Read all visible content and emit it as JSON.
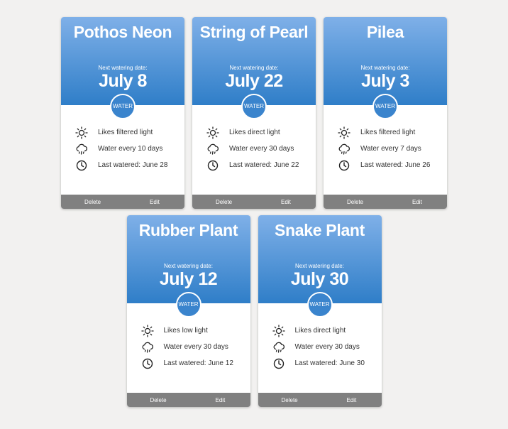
{
  "plants": [
    {
      "name": "Pothos Neon",
      "next_label": "Next watering date:",
      "next_date": "July 8",
      "water_label": "WATER",
      "light": "Likes filtered light",
      "water_freq": "Water every 10 days",
      "last_watered": "Last watered: June 28",
      "delete_label": "Delete",
      "edit_label": "Edit"
    },
    {
      "name": "String of Pearl",
      "next_label": "Next watering date:",
      "next_date": "July 22",
      "water_label": "WATER",
      "light": "Likes direct light",
      "water_freq": "Water every 30 days",
      "last_watered": "Last watered: June 22",
      "delete_label": "Delete",
      "edit_label": "Edit"
    },
    {
      "name": "Pilea",
      "next_label": "Next watering date:",
      "next_date": "July 3",
      "water_label": "WATER",
      "light": "Likes filtered light",
      "water_freq": "Water every 7 days",
      "last_watered": "Last watered: June 26",
      "delete_label": "Delete",
      "edit_label": "Edit"
    },
    {
      "name": "Rubber Plant",
      "next_label": "Next watering date:",
      "next_date": "July 12",
      "water_label": "WATER",
      "light": "Likes low light",
      "water_freq": "Water every 30 days",
      "last_watered": "Last watered: June 12",
      "delete_label": "Delete",
      "edit_label": "Edit"
    },
    {
      "name": "Snake Plant",
      "next_label": "Next watering date:",
      "next_date": "July 30",
      "water_label": "WATER",
      "light": "Likes direct light",
      "water_freq": "Water every 30 days",
      "last_watered": "Last watered: June 30",
      "delete_label": "Delete",
      "edit_label": "Edit"
    }
  ],
  "icons": {
    "light": "sun-icon",
    "water": "rain-cloud-icon",
    "last": "clock-icon"
  },
  "colors": {
    "header_top": "#7fb0e8",
    "header_bottom": "#2f7ec8",
    "footer": "#808080",
    "background": "#f2f1f0"
  }
}
